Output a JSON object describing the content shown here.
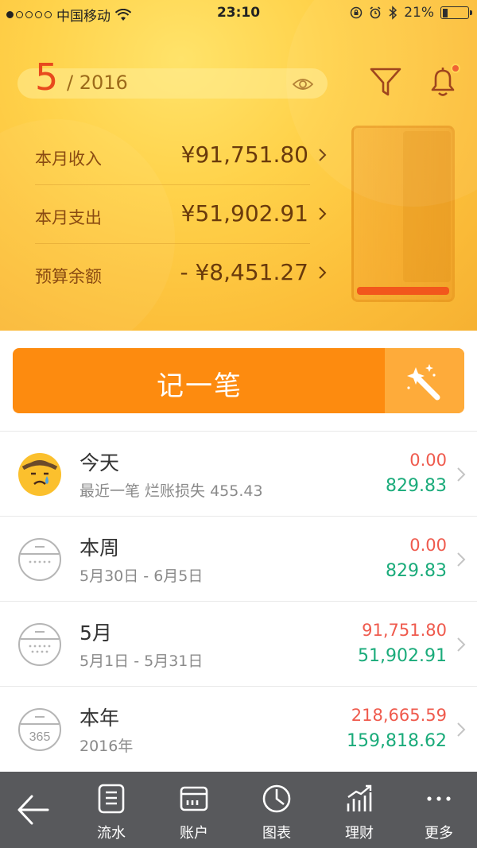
{
  "status_bar": {
    "carrier": "中国移动",
    "time": "23:10",
    "battery": "21%",
    "battery_level": 0.21
  },
  "header": {
    "month": "5",
    "year": "/ 2016",
    "income": {
      "label": "本月收入",
      "value": "¥91,751.80"
    },
    "expense": {
      "label": "本月支出",
      "value": "¥51,902.91"
    },
    "budget": {
      "label": "预算余额",
      "value": "- ¥8,451.27"
    },
    "budget_jar_fill": 0.05
  },
  "record_button": {
    "label": "记一笔"
  },
  "periods": [
    {
      "title": "今天",
      "subtitle": "最近一笔 烂账损失 455.43",
      "income": "0.00",
      "expense": "829.83",
      "icon": "sad-face-icon"
    },
    {
      "title": "本周",
      "subtitle": "5月30日 - 6月5日",
      "income": "0.00",
      "expense": "829.83",
      "icon": "calendar-week-icon"
    },
    {
      "title": "5月",
      "subtitle": "5月1日 - 5月31日",
      "income": "91,751.80",
      "expense": "51,902.91",
      "icon": "calendar-month-icon"
    },
    {
      "title": "本年",
      "subtitle": "2016年",
      "income": "218,665.59",
      "expense": "159,818.62",
      "icon": "calendar-year-icon",
      "icon_text": "365"
    }
  ],
  "tabs": [
    {
      "label": "流水",
      "icon": "ledger-icon"
    },
    {
      "label": "账户",
      "icon": "wallet-icon"
    },
    {
      "label": "图表",
      "icon": "pie-chart-icon"
    },
    {
      "label": "理财",
      "icon": "trend-icon"
    },
    {
      "label": "更多",
      "icon": "more-icon"
    }
  ],
  "colors": {
    "accent": "#fd8b0f",
    "income": "#ef5a4d",
    "expense": "#1aab7a",
    "tabbar": "#58595c"
  }
}
